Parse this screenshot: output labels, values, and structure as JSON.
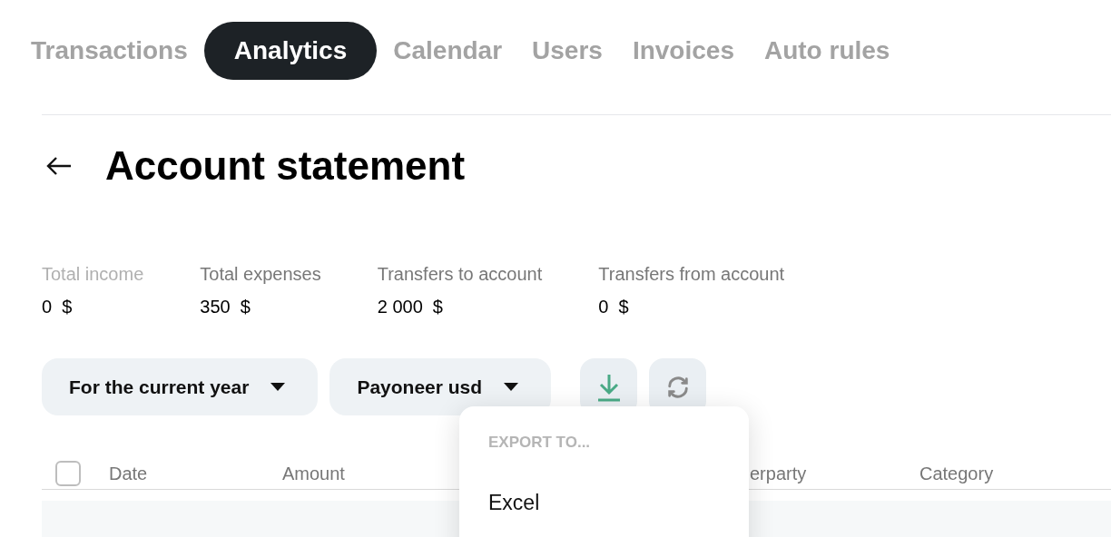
{
  "tabs": [
    {
      "label": "Transactions",
      "selected": false
    },
    {
      "label": "Analytics",
      "selected": true
    },
    {
      "label": "Calendar",
      "selected": false
    },
    {
      "label": "Users",
      "selected": false
    },
    {
      "label": "Invoices",
      "selected": false
    },
    {
      "label": "Auto rules",
      "selected": false
    }
  ],
  "page": {
    "title": "Account statement"
  },
  "stats": [
    {
      "label": "Total income",
      "value": "0  $",
      "dimmed": true
    },
    {
      "label": "Total expenses",
      "value": "350  $",
      "dimmed": false
    },
    {
      "label": "Transfers to account",
      "value": "2 000  $",
      "dimmed": false
    },
    {
      "label": "Transfers from account",
      "value": "0  $",
      "dimmed": false
    }
  ],
  "filters": [
    {
      "label": "For the current year"
    },
    {
      "label": "Payoneer usd"
    }
  ],
  "export_menu": {
    "heading": "EXPORT TO...",
    "items": [
      "Excel"
    ]
  },
  "table": {
    "select_all_checked": false,
    "columns": [
      "Date",
      "Amount",
      "erparty",
      "Category"
    ]
  }
}
